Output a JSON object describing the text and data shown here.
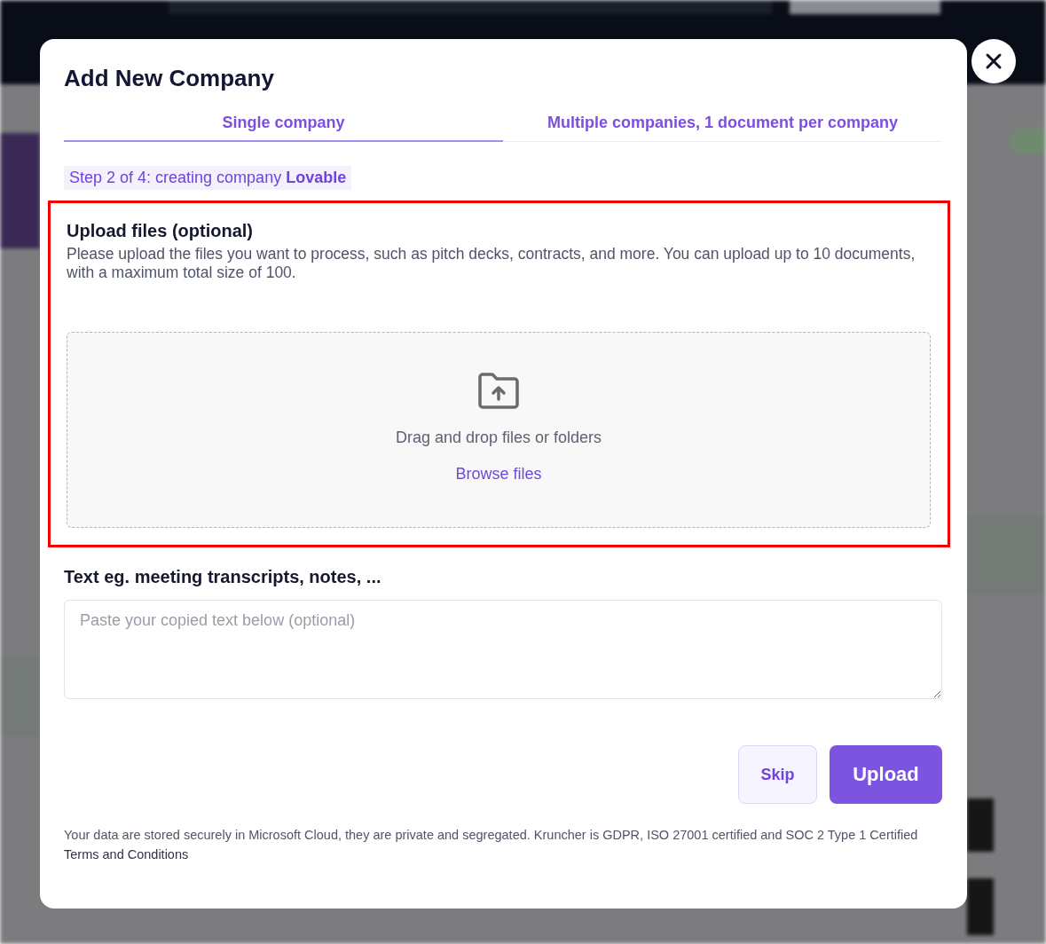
{
  "dialog": {
    "title": "Add New Company",
    "tabs": [
      {
        "label": "Single company",
        "selected": true
      },
      {
        "label": "Multiple companies, 1 document per company",
        "selected": false
      }
    ],
    "step": "Step 2 of 4: creating company **Lovable**",
    "upload": {
      "highlighted": true,
      "title": "Upload files (optional)",
      "description": "Please upload the files you want to process, such as pitch decks, contracts, and more. You can upload up to 10 documents, with a maximum total size of 100.",
      "drop_text": "Drag and drop files or folders",
      "browse_link": "Browse files"
    },
    "text_section": {
      "title": "Text eg. meeting transcripts, notes, ...",
      "placeholder": "Paste your copied text below (optional)"
    },
    "buttons": [
      {
        "label": "Skip",
        "kind": "secondary"
      },
      {
        "label": "Upload",
        "kind": "primary"
      }
    ],
    "footer": {
      "text": "Your data are stored securely in Microsoft Cloud, they are private and segregated. Kruncher is GDPR, ISO 27001 certified and SOC 2 Type 1 Certified",
      "link": "Terms and Conditions"
    }
  }
}
